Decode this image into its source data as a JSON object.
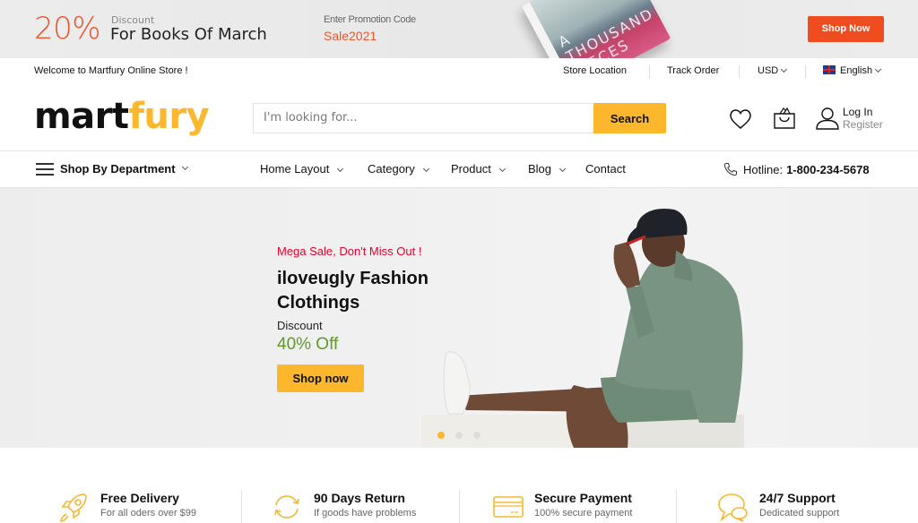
{
  "promo": {
    "percent": "20%",
    "discount_label": "Discount",
    "discount_title": "For Books Of March",
    "code_label": "Enter Promotion Code",
    "code": "Sale2021",
    "book_text": "A THOUSAND PIECES",
    "shop_now_label": "Shop Now"
  },
  "topbar": {
    "welcome": "Welcome to Martfury Online Store !",
    "links": [
      "Store Location",
      "Track Order"
    ],
    "currency": "USD",
    "language": "English"
  },
  "header": {
    "logo_part1": "mart",
    "logo_part2": "fury",
    "search_placeholder": "I'm looking for...",
    "search_label": "Search",
    "login_label": "Log In",
    "register_label": "Register"
  },
  "nav": {
    "department_label": "Shop By Department",
    "items": [
      "Home Layout",
      "Category",
      "Product",
      "Blog",
      "Contact"
    ],
    "hotline_label": "Hotline:",
    "hotline_number": "1-800-234-5678"
  },
  "hero": {
    "tagline": "Mega Sale, Don't Miss Out !",
    "title": "iloveugly Fashion Clothings",
    "discount_label": "Discount",
    "offer": "40% Off",
    "cta_label": "Shop now",
    "slides_total": 3,
    "active_slide": 1
  },
  "features": [
    {
      "icon": "rocket-icon",
      "title": "Free Delivery",
      "subtitle": "For all oders over $99"
    },
    {
      "icon": "refresh-icon",
      "title": "90 Days Return",
      "subtitle": "If goods have problems"
    },
    {
      "icon": "credit-card-icon",
      "title": "Secure Payment",
      "subtitle": "100% secure payment"
    },
    {
      "icon": "chat-icon",
      "title": "24/7 Support",
      "subtitle": "Dedicated support"
    }
  ],
  "colors": {
    "brand_yellow": "#fcb72c",
    "promo_orange": "#ef4c1f",
    "sale_red": "#e3002b",
    "offer_green": "#5e9a2a"
  }
}
